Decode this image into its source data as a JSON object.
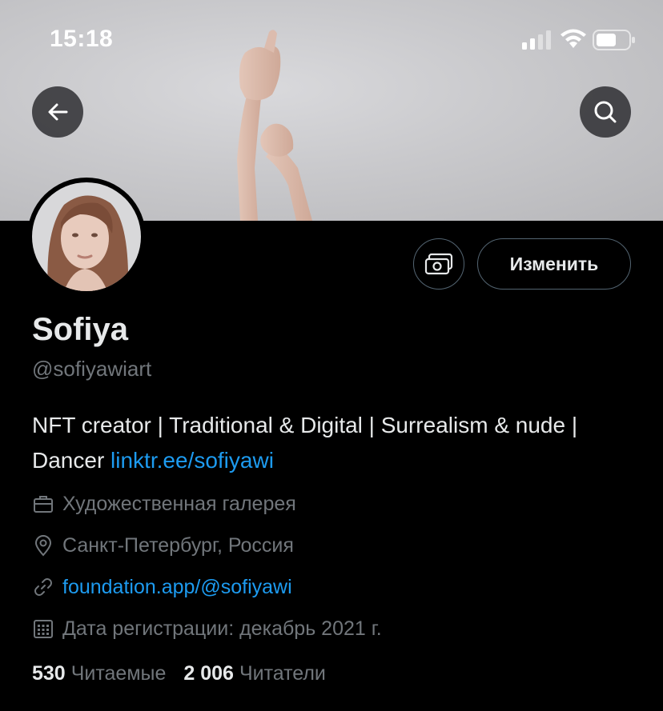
{
  "status_bar": {
    "time": "15:18"
  },
  "header": {
    "back_icon": "arrow-left-icon",
    "search_icon": "search-icon"
  },
  "profile": {
    "name": "Sofiya",
    "handle": "@sofiyawiart",
    "edit_label": "Изменить",
    "tip_icon": "money-icon",
    "bio_text": "NFT creator | Traditional & Digital | Surrealism & nude | Dancer ",
    "bio_link": "linktr.ee/sofiyawi",
    "category": "Художественная галерея",
    "location": "Санкт-Петербург, Россия",
    "website": "foundation.app/@sofiyawi",
    "joined": "Дата регистрации: декабрь 2021 г.",
    "following_count": "530",
    "following_label": "Читаемые",
    "followers_count": "2 006",
    "followers_label": "Читатели"
  },
  "colors": {
    "accent": "#1d9bf0",
    "muted": "#71767b",
    "background": "#000000",
    "text": "#e7e9ea"
  }
}
